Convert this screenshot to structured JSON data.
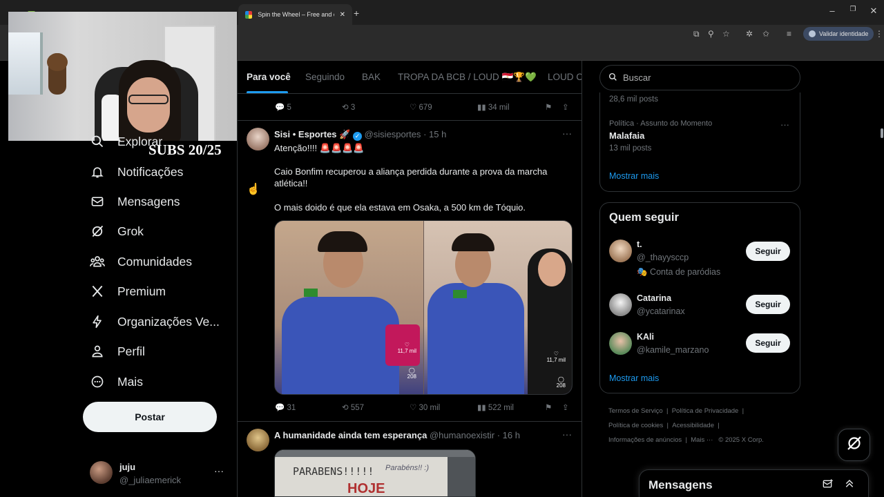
{
  "browser": {
    "tabs": [
      {
        "label": "",
        "active": false
      },
      {
        "label": "",
        "active": false
      },
      {
        "label": "Spin the Wheel – Free and easy",
        "active": true
      }
    ],
    "new_tab": "+",
    "win_controls": [
      "–",
      "❐",
      "✕"
    ],
    "validate_label": "Validar identidade"
  },
  "stream": {
    "subs": "SUBS 20/25"
  },
  "nav": {
    "items": [
      {
        "label": "Explorar",
        "icon": "search-icon"
      },
      {
        "label": "Notificações",
        "icon": "bell-icon"
      },
      {
        "label": "Mensagens",
        "icon": "envelope-icon"
      },
      {
        "label": "Grok",
        "icon": "grok-icon"
      },
      {
        "label": "Comunidades",
        "icon": "people-icon"
      },
      {
        "label": "Premium",
        "icon": "x-logo-icon"
      },
      {
        "label": "Organizações Ve...",
        "icon": "lightning-icon"
      },
      {
        "label": "Perfil",
        "icon": "person-icon"
      },
      {
        "label": "Mais",
        "icon": "more-circle-icon"
      }
    ],
    "post_button": "Postar",
    "account": {
      "name": "juju",
      "handle": "@_juliaemerick",
      "more": "···"
    }
  },
  "feed": {
    "tabs": [
      "Para você",
      "Seguindo",
      "BAK",
      "TROPA DA BCB / LOUD 🇪🇬🏆💚",
      "LOUD Co"
    ],
    "prev_post_actions": {
      "replies": "5",
      "reposts": "3",
      "likes": "679",
      "views": "34 mil"
    },
    "post1": {
      "name": "Sisi • Esportes 🚀",
      "handle": "@sisiesportes",
      "time": "· 15 h",
      "more": "···",
      "text1": "Atenção!!!! 🚨🚨🚨🚨",
      "text2": "Caio Bonfim recuperou a aliança perdida durante a prova da marcha atlética!!",
      "text3": "O mais doido é que ela estava em Osaka, a 500 km de Tóquio.",
      "media_likes": "11,7 mil",
      "media_comments": "208",
      "actions": {
        "replies": "31",
        "reposts": "557",
        "likes": "30 mil",
        "views": "522 mil"
      }
    },
    "post2": {
      "name": "A humanidade ainda tem esperança",
      "handle": "@humanoexistir",
      "time": "· 16 h",
      "more": "···",
      "sign_text1": "PARABENS!!!!!",
      "sign_text2": "Parabéns!! :)",
      "sign_text3": "HOJE"
    }
  },
  "right": {
    "search_placeholder": "Buscar",
    "trends": {
      "top_count": "28,6 mil posts",
      "item_context": "Política · Assunto do Momento",
      "item_title": "Malafaia",
      "item_count": "13 mil posts",
      "more": "···",
      "show_more": "Mostrar mais"
    },
    "who_to_follow": {
      "title": "Quem seguir",
      "users": [
        {
          "name": "t.",
          "handle": "@_thayysccp",
          "note": "🎭 Conta de paródias",
          "button": "Seguir"
        },
        {
          "name": "Catarina",
          "handle": "@ycatarinax",
          "button": "Seguir"
        },
        {
          "name": "KAli",
          "handle": "@kamile_marzano",
          "button": "Seguir"
        }
      ],
      "show_more": "Mostrar mais"
    },
    "footer": {
      "line1": [
        "Termos de Serviço",
        "|",
        "Política de Privacidade",
        "|"
      ],
      "line2": [
        "Política de cookies",
        "|",
        "Acessibilidade",
        "|"
      ],
      "line3": [
        "Informações de anúncios",
        "|",
        "Mais ···",
        "© 2025 X Corp."
      ]
    },
    "messages_drawer": "Mensagens"
  },
  "colors": {
    "accent": "#1d9bf0",
    "background": "#000000",
    "border": "#2f3336",
    "muted": "#71767b"
  }
}
